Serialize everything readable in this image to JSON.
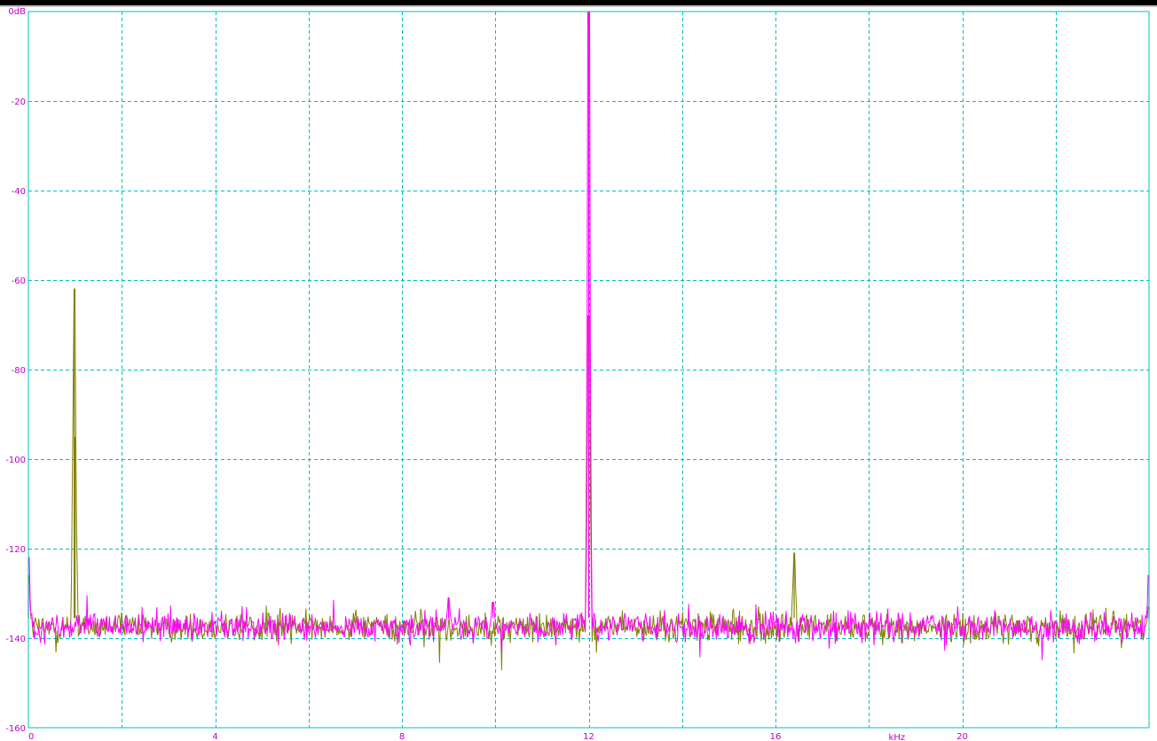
{
  "chart_data": {
    "type": "line",
    "title": "",
    "xlabel": "kHz",
    "ylabel": "",
    "xlim": [
      0,
      24
    ],
    "ylim": [
      -160,
      0
    ],
    "x_ticks": [
      0,
      4,
      8,
      12,
      16,
      20
    ],
    "x_tick_labels": [
      "0",
      "4",
      "8",
      "12",
      "16",
      "20"
    ],
    "y_ticks": [
      0,
      -20,
      -40,
      -60,
      -80,
      -100,
      -120,
      -140,
      -160
    ],
    "y_tick_labels": [
      "0dB",
      "-20",
      "-40",
      "-60",
      "-80",
      "-100",
      "-120",
      "-140",
      "-160"
    ],
    "grid": true,
    "x_grid_step_khz": 2,
    "y_grid_step_db": 20,
    "noise_floor_db": -137.5,
    "series": [
      {
        "color": "#808000",
        "baseline_db": -137.5,
        "peaks": [
          {
            "x": 0.0,
            "y": -126
          },
          {
            "x": 0.98,
            "y": -62
          },
          {
            "x": 1.0,
            "y": -95
          },
          {
            "x": 12.0,
            "y": -68
          },
          {
            "x": 16.4,
            "y": -121
          },
          {
            "x": 24.0,
            "y": -133
          }
        ]
      },
      {
        "color": "#ff00ff",
        "baseline_db": -137.5,
        "peaks": [
          {
            "x": 0.0,
            "y": -122
          },
          {
            "x": 9.0,
            "y": -131
          },
          {
            "x": 9.95,
            "y": -132
          },
          {
            "x": 12.0,
            "y": 0
          },
          {
            "x": 24.0,
            "y": -126
          }
        ]
      }
    ],
    "colors": {
      "axis": "#00c0c0",
      "grid": "#00c0c0",
      "tick_text": "#c000c0"
    }
  }
}
